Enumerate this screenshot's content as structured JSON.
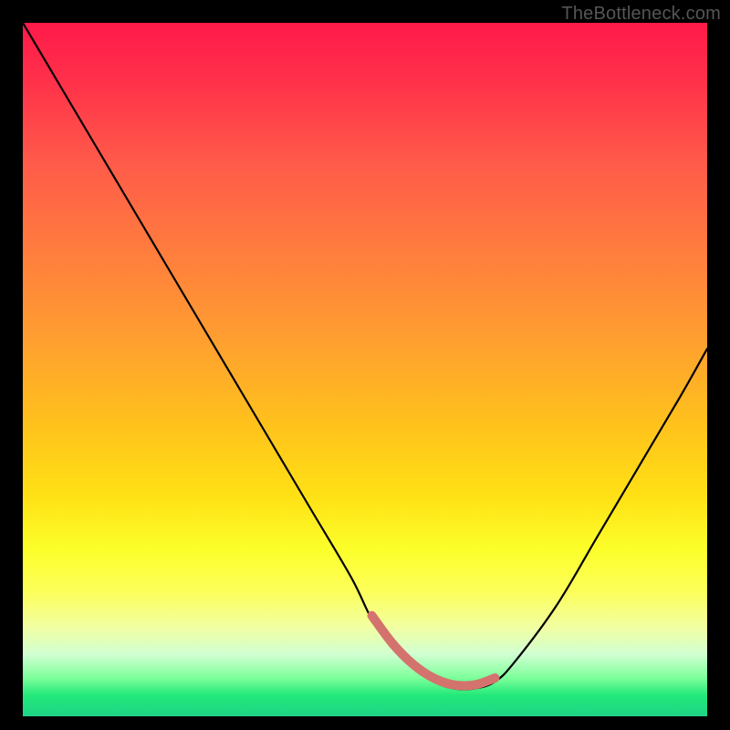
{
  "watermark": "TheBottleneck.com",
  "chart_data": {
    "type": "line",
    "title": "",
    "xlabel": "",
    "ylabel": "",
    "xlim": [
      0,
      100
    ],
    "ylim": [
      0,
      100
    ],
    "series": [
      {
        "name": "bottleneck-curve",
        "x": [
          0,
          6,
          12,
          18,
          24,
          30,
          36,
          42,
          48,
          51,
          54,
          57,
          60,
          63,
          66,
          69,
          72,
          78,
          84,
          90,
          96,
          100
        ],
        "values": [
          100,
          90,
          80,
          70,
          60,
          50,
          40,
          30,
          20,
          14,
          10,
          7,
          5,
          4,
          4,
          5,
          8,
          16,
          26,
          36,
          46,
          53
        ]
      }
    ],
    "gradient_stops": [
      {
        "pos": 0,
        "color": "#ff1a4a"
      },
      {
        "pos": 0.5,
        "color": "#ffe015"
      },
      {
        "pos": 0.9,
        "color": "#f2ffa0"
      },
      {
        "pos": 1.0,
        "color": "#1ed486"
      }
    ],
    "valley_marker": {
      "x_start": 51,
      "x_end": 69,
      "color": "#d4736e"
    }
  }
}
